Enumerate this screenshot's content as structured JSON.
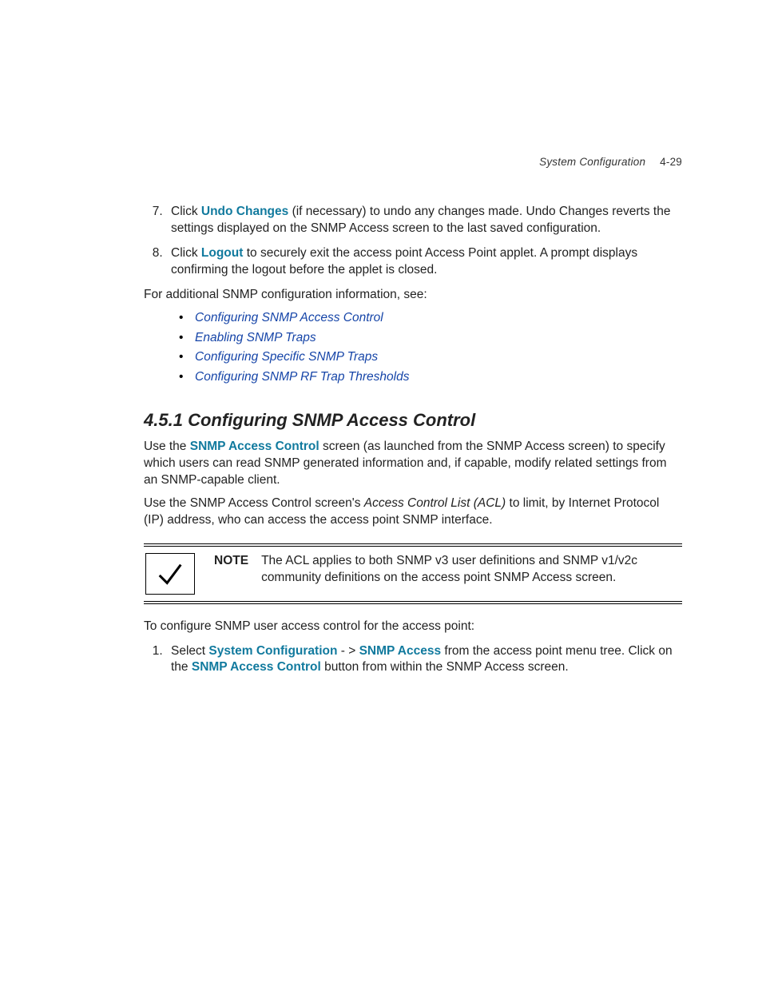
{
  "header": {
    "title": "System Configuration",
    "page": "4-29"
  },
  "steps": [
    {
      "num": "7.",
      "pre": "Click ",
      "bold": "Undo Changes",
      "post": " (if necessary) to undo any changes made. Undo Changes reverts the settings displayed on the SNMP Access screen to the last saved configuration."
    },
    {
      "num": "8.",
      "pre": "Click ",
      "bold": "Logout",
      "post": " to securely exit the access point Access Point applet. A prompt displays confirming the logout before the applet is closed."
    }
  ],
  "additional_intro": "For additional SNMP configuration information, see:",
  "links": [
    "Configuring SNMP Access Control",
    "Enabling SNMP Traps",
    "Configuring Specific SNMP Traps",
    "Configuring SNMP RF Trap Thresholds"
  ],
  "section": {
    "number": "4.5.1",
    "title": "Configuring SNMP Access Control"
  },
  "para1": {
    "pre": "Use the ",
    "bold": "SNMP Access Control",
    "post": " screen (as launched from the SNMP Access screen) to specify which users can read SNMP generated information and, if capable, modify related settings from an SNMP-capable client."
  },
  "para2": {
    "pre": "Use the SNMP Access Control screen's ",
    "em": "Access Control List (ACL)",
    "post": " to limit, by Internet Protocol (IP) address, who can access the access point SNMP interface."
  },
  "note": {
    "label": "NOTE",
    "text": "The ACL applies to both SNMP v3 user definitions and SNMP v1/v2c community definitions on the access point SNMP Access screen."
  },
  "config_intro": "To configure SNMP user access control for the access point:",
  "step2": {
    "num": "1.",
    "pre": "Select ",
    "bold1": "System Configuration",
    "mid1": " - > ",
    "bold2": "SNMP Access",
    "mid2": " from the access point menu tree. Click on the ",
    "bold3": "SNMP Access Control",
    "post": " button from within the SNMP Access screen."
  }
}
